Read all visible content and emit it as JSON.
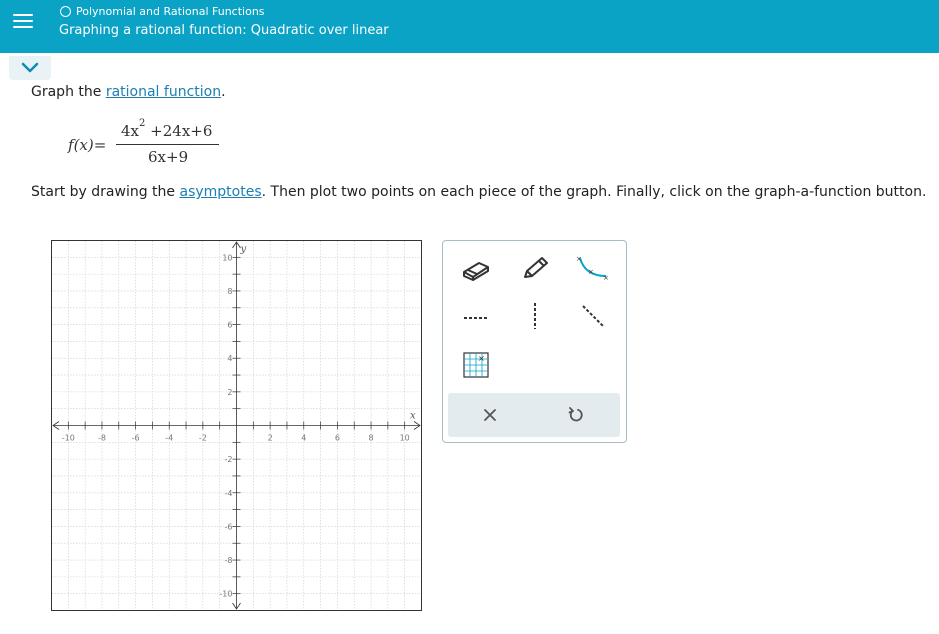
{
  "header": {
    "topic": "Polynomial and Rational Functions",
    "title": "Graphing a rational function: Quadratic over linear"
  },
  "problem": {
    "prompt_prefix": "Graph the ",
    "prompt_link": "rational function",
    "prompt_suffix": ".",
    "function_lhs": "f",
    "function_arg": "(x)",
    "function_eq": "=",
    "numerator_a": "4x",
    "numerator_exp": "2",
    "numerator_b": "+24x+6",
    "denominator": "6x+9",
    "instruction_prefix": "Start by drawing the ",
    "instruction_link": "asymptotes",
    "instruction_suffix": ". Then plot two points on each piece of the graph. Finally, click on the graph-a-function button."
  },
  "graph": {
    "x_label": "x",
    "y_label": "y",
    "x_ticks": [
      "-10",
      "-8",
      "-6",
      "-4",
      "-2",
      "2",
      "4",
      "6",
      "8",
      "10"
    ],
    "y_ticks": [
      "10",
      "8",
      "6",
      "4",
      "2",
      "-2",
      "-4",
      "-6",
      "-8",
      "-10"
    ],
    "xlim": [
      -11,
      11
    ],
    "ylim": [
      -11,
      11
    ]
  },
  "toolbox": {
    "tools": [
      {
        "icon": "eraser-icon"
      },
      {
        "icon": "pencil-icon"
      },
      {
        "icon": "curve-tool-icon"
      },
      {
        "icon": "horizontal-asymptote-icon"
      },
      {
        "icon": "vertical-asymptote-icon"
      },
      {
        "icon": "oblique-asymptote-icon"
      },
      {
        "icon": "graph-function-icon"
      }
    ],
    "actions": [
      {
        "icon": "clear-icon"
      },
      {
        "icon": "undo-icon"
      }
    ]
  },
  "colors": {
    "header": "#0aa3c6",
    "link": "#1b7fb3",
    "tool_accent": "#0aa3c6"
  }
}
